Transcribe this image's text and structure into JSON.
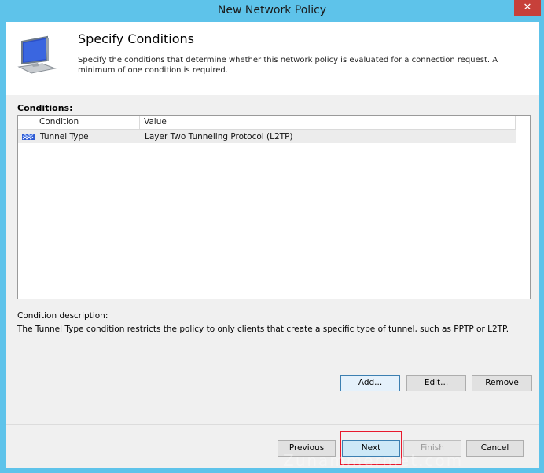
{
  "window": {
    "title": "New Network Policy",
    "close_label": "✕"
  },
  "header": {
    "heading": "Specify Conditions",
    "description": "Specify the conditions that determine whether this network policy is evaluated for a connection request. A minimum of one condition is required."
  },
  "conditions": {
    "label": "Conditions:",
    "columns": [
      "Condition",
      "Value"
    ],
    "rows": [
      {
        "condition": "Tunnel Type",
        "value": "Layer Two Tunneling Protocol (L2TP)",
        "icon": "tunnel-icon"
      }
    ]
  },
  "condition_description": {
    "label": "Condition description:",
    "text": "The Tunnel Type condition restricts the policy to only clients that create a specific type of tunnel, such as PPTP or L2TP."
  },
  "actions": {
    "add": "Add...",
    "edit": "Edit...",
    "remove": "Remove"
  },
  "navigation": {
    "previous": "Previous",
    "next": "Next",
    "finish": "Finish",
    "cancel": "Cancel"
  },
  "watermark": "Zunammermet.com",
  "colors": {
    "titlebar": "#5ec3ea",
    "close": "#c7403a",
    "highlight": "#e8192c"
  }
}
